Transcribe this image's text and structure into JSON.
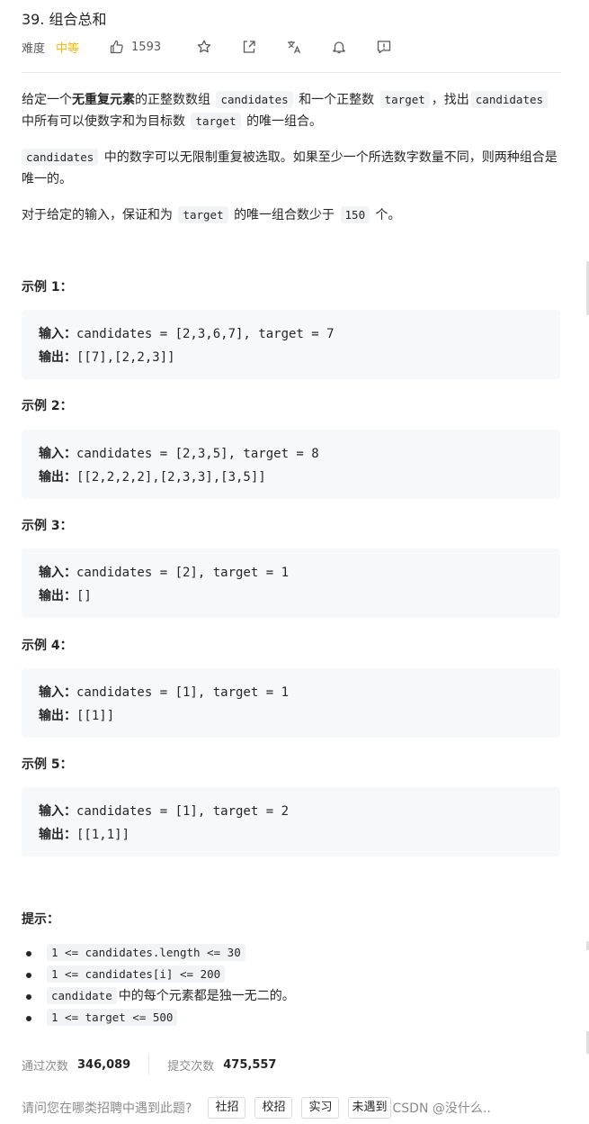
{
  "problem": {
    "title": "39. 组合总和",
    "difficulty_label": "难度",
    "difficulty": "中等",
    "likes": "1593"
  },
  "description": {
    "p1_a": "给定一个",
    "p1_bold": "无重复元素",
    "p1_b": "的正整数数组",
    "p1_code1": "candidates",
    "p1_c": "和一个正整数",
    "p1_code2": "target",
    "p1_d": "，找出",
    "p1_code3": "candidates",
    "p1_e": "中所有可以使数字和为目标数",
    "p1_code4": "target",
    "p1_f": "的唯一组合。",
    "p2_code": "candidates",
    "p2_text": "中的数字可以无限制重复被选取。如果至少一个所选数字数量不同，则两种组合是唯一的。",
    "p3_a": "对于给定的输入，保证和为",
    "p3_code1": "target",
    "p3_b": "的唯一组合数少于",
    "p3_code2": "150",
    "p3_c": "个。"
  },
  "examples": [
    {
      "title": "示例 1：",
      "input_label": "输入：",
      "input": "candidates = [2,3,6,7], target = 7",
      "output_label": "输出：",
      "output": "[[7],[2,2,3]]"
    },
    {
      "title": "示例 2：",
      "input_label": "输入：",
      "input": "candidates = [2,3,5], target = 8",
      "output_label": "输出：",
      "output": "[[2,2,2,2],[2,3,3],[3,5]]"
    },
    {
      "title": "示例 3：",
      "input_label": "输入：",
      "input": "candidates = [2], target = 1",
      "output_label": "输出：",
      "output": "[]"
    },
    {
      "title": "示例 4：",
      "input_label": "输入：",
      "input": "candidates = [1], target = 1",
      "output_label": "输出：",
      "output": "[[1]]"
    },
    {
      "title": "示例 5：",
      "input_label": "输入：",
      "input": "candidates = [1], target = 2",
      "output_label": "输出：",
      "output": "[[1,1]]"
    }
  ],
  "hints": {
    "title": "提示：",
    "items": [
      {
        "code": "1 <= candidates.length <= 30",
        "text": ""
      },
      {
        "code": "1 <= candidates[i] <= 200",
        "text": ""
      },
      {
        "code": "candidate",
        "text": "中的每个元素都是独一无二的。"
      },
      {
        "code": "1 <= target <= 500",
        "text": ""
      }
    ]
  },
  "stats": {
    "accepted_label": "通过次数",
    "accepted": "346,089",
    "submissions_label": "提交次数",
    "submissions": "475,557"
  },
  "survey": {
    "question": "请问您在哪类招聘中遇到此题?",
    "options": [
      "社招",
      "校招",
      "实习",
      "未遇到"
    ]
  },
  "watermark": "CSDN @没什么..",
  "icons": {
    "like": "thumbs-up-icon",
    "star": "star-icon",
    "share": "share-icon",
    "translate": "translate-icon",
    "notify": "bell-icon",
    "feedback": "feedback-icon"
  }
}
